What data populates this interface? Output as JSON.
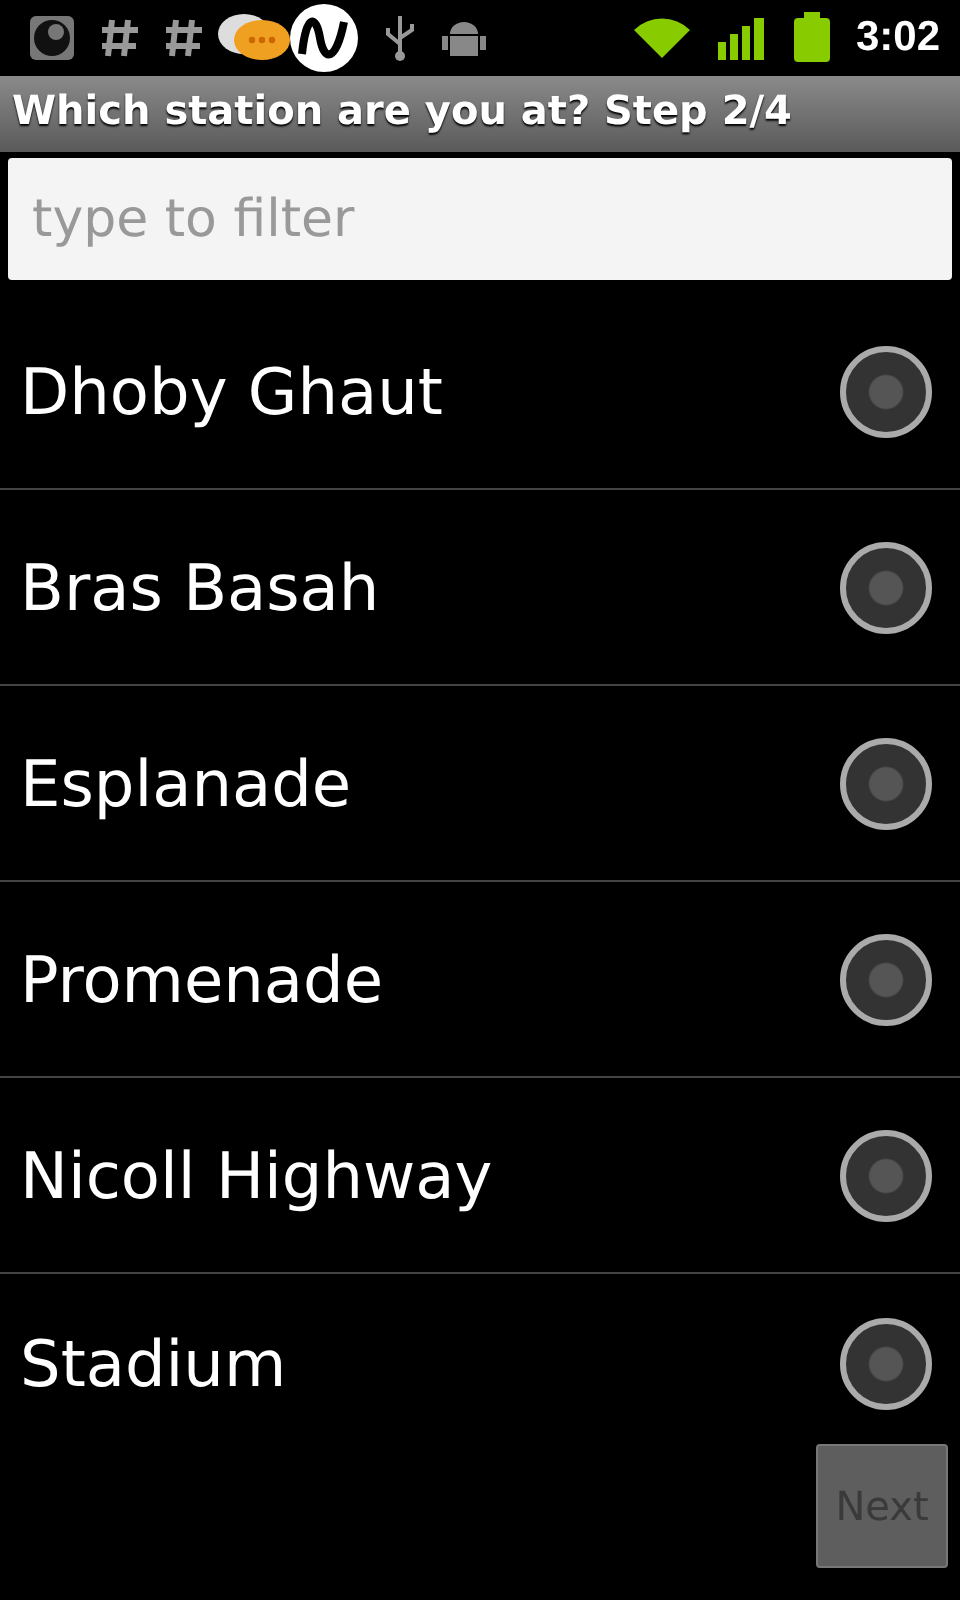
{
  "status_bar": {
    "time": "3:02"
  },
  "title": "Which station are you at? Step 2/4",
  "filter": {
    "placeholder": "type to filter"
  },
  "stations": [
    {
      "name": "Dhoby Ghaut",
      "selected": false
    },
    {
      "name": "Bras Basah",
      "selected": false
    },
    {
      "name": "Esplanade",
      "selected": false
    },
    {
      "name": "Promenade",
      "selected": false
    },
    {
      "name": "Nicoll Highway",
      "selected": false
    },
    {
      "name": "Stadium",
      "selected": false
    }
  ],
  "next_button": {
    "label": "Next",
    "disabled": true
  }
}
